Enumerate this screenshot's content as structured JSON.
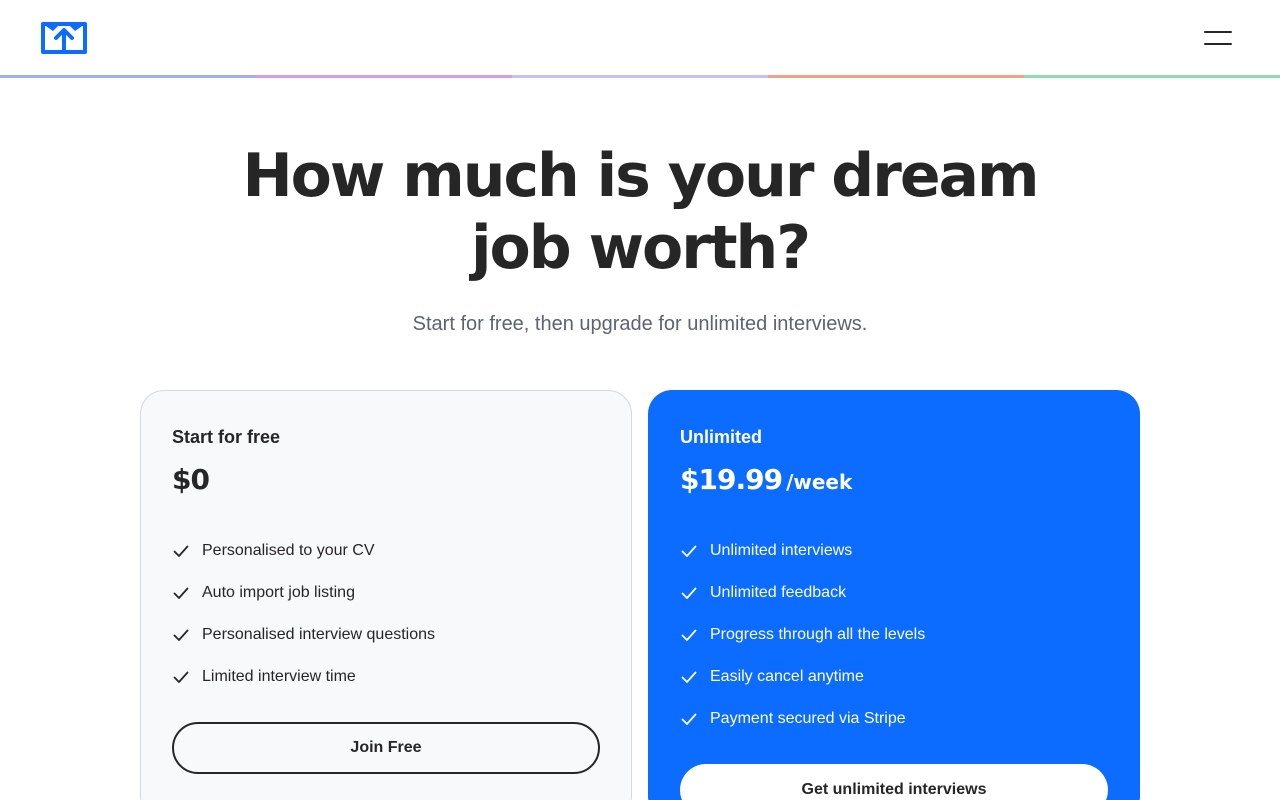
{
  "header": {
    "logo_icon": "box-upload-icon",
    "menu_icon": "hamburger-menu-icon",
    "stripe_colors": [
      "#a0b0ec",
      "#d99ae8",
      "#c6c2f0",
      "#f0a189",
      "#8fdcb0"
    ]
  },
  "hero": {
    "title_line1": "How much is your dream",
    "title_line2": "job worth?",
    "subtitle": "Start for free, then upgrade for unlimited interviews."
  },
  "plans": {
    "free": {
      "name": "Start for free",
      "price": "$0",
      "features": [
        "Personalised to your CV",
        "Auto import job listing",
        "Personalised interview questions",
        "Limited interview time"
      ],
      "button": "Join Free"
    },
    "pro": {
      "name": "Unlimited",
      "price": "$19.99",
      "period": "/week",
      "features": [
        "Unlimited interviews",
        "Unlimited feedback",
        "Progress through all the levels",
        "Easily cancel anytime",
        "Payment secured via Stripe"
      ],
      "button": "Get unlimited interviews"
    }
  },
  "colors": {
    "accent": "#0b6cff",
    "text": "#262626",
    "muted": "#5b6472",
    "card_bg": "#f8f9fb"
  }
}
